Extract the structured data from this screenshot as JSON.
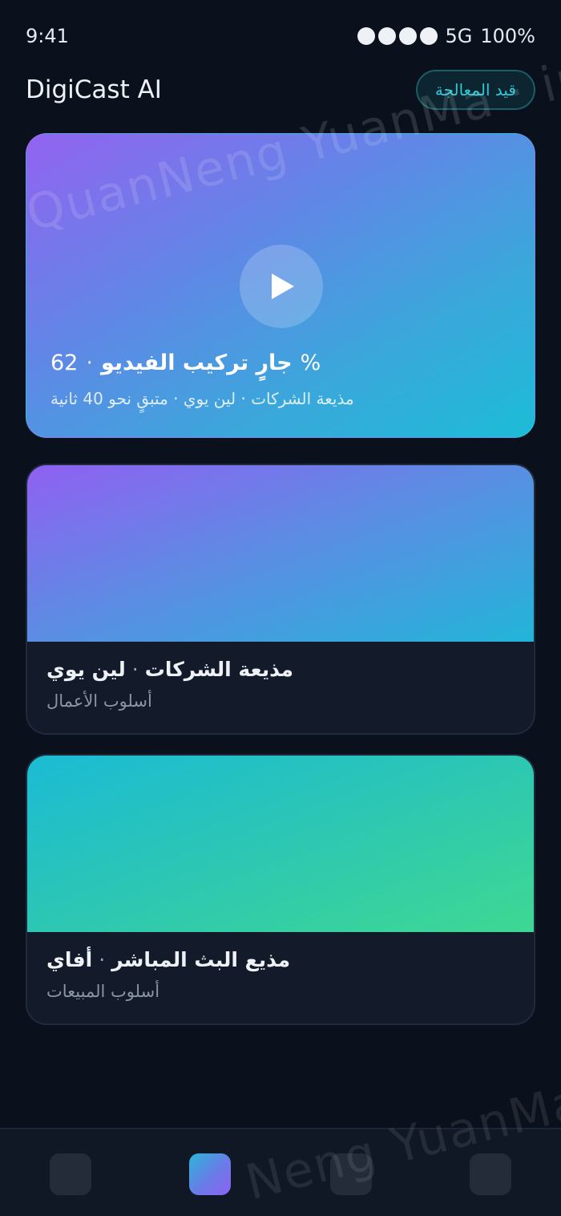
{
  "status_bar": {
    "time": "9:41",
    "network": "5G",
    "battery": "100%"
  },
  "header": {
    "app_title": "DigiCast AI",
    "badge": "قيد المعالجة"
  },
  "hero": {
    "progress_text": "62",
    "status_text": "جارٍ تركيب الفيديو",
    "percent_sign": "%",
    "subtitle": "مذيعة الشركات · لين يوي · متبقٍ نحو 40 ثانية"
  },
  "cards": [
    {
      "name": "مذيعة الشركات",
      "person": "لين يوي",
      "style": "أسلوب الأعمال"
    },
    {
      "name": "مذيع البث المباشر",
      "person": "أفاي",
      "style": "أسلوب المبيعات"
    }
  ],
  "watermark": "QuanNeng YuanMa · in",
  "watermark_bottom": "Neng YuanMa",
  "colors": {
    "background": "#0b111c",
    "accent": "#2fc9d6"
  }
}
